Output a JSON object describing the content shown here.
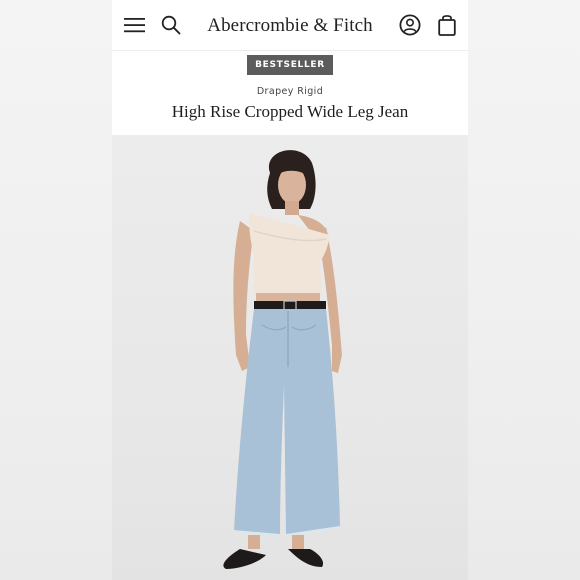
{
  "header": {
    "brand": "Abercrombie & Fitch",
    "menu_icon": "hamburger-menu-icon",
    "search_icon": "search-icon",
    "account_icon": "account-icon",
    "bag_icon": "shopping-bag-icon"
  },
  "product": {
    "badge": "BESTSELLER",
    "fit_label": "Drapey Rigid",
    "name": "High Rise Cropped Wide Leg Jean"
  },
  "colors": {
    "badge_bg": "#5c5c5c",
    "denim": "#a9c1d6",
    "top": "#f1e5da"
  }
}
